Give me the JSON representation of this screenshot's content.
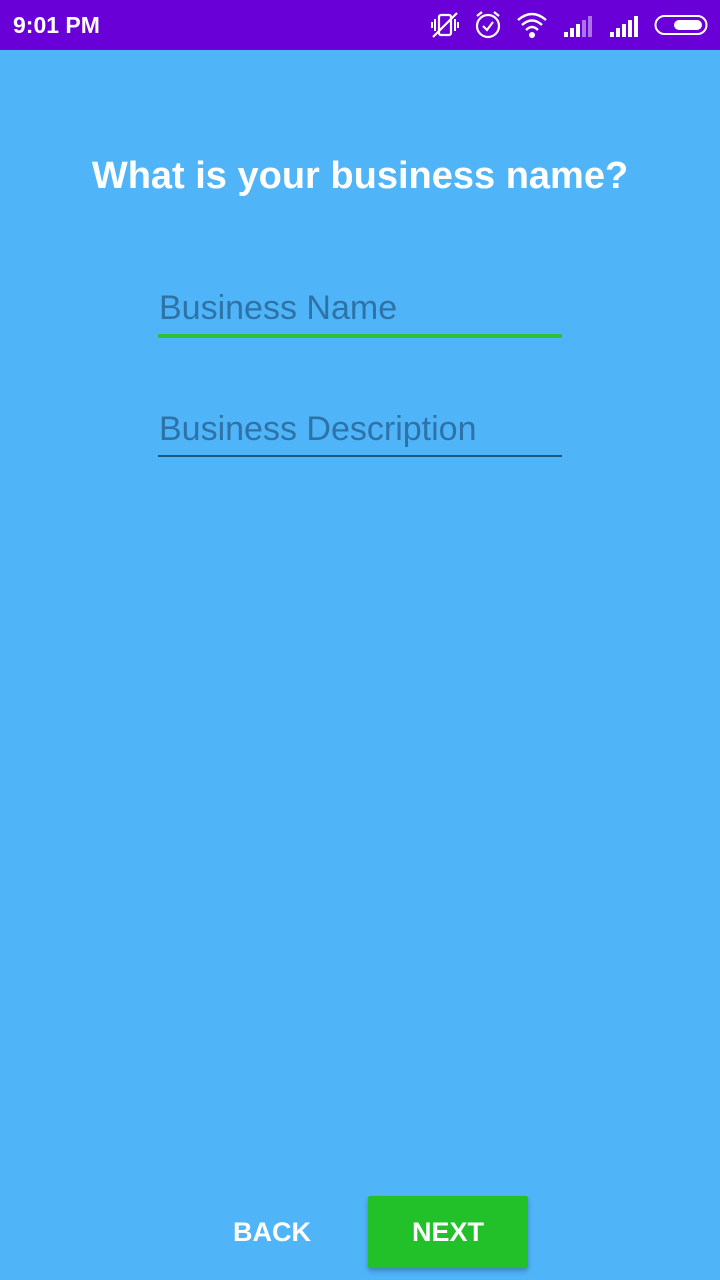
{
  "status_bar": {
    "time": "9:01 PM",
    "icons": [
      "vibrate-off-icon",
      "alarm-icon",
      "wifi-icon",
      "signal-icon",
      "signal-icon",
      "battery-icon"
    ],
    "background": "#6a00d8"
  },
  "page": {
    "background": "#50b4f8",
    "title": "What is your business name?"
  },
  "form": {
    "business_name": {
      "value": "",
      "placeholder": "Business Name",
      "accent": "#2ec235"
    },
    "business_description": {
      "value": "",
      "placeholder": "Business Description"
    }
  },
  "footer": {
    "back_label": "BACK",
    "next_label": "NEXT",
    "next_color": "#22c029"
  }
}
